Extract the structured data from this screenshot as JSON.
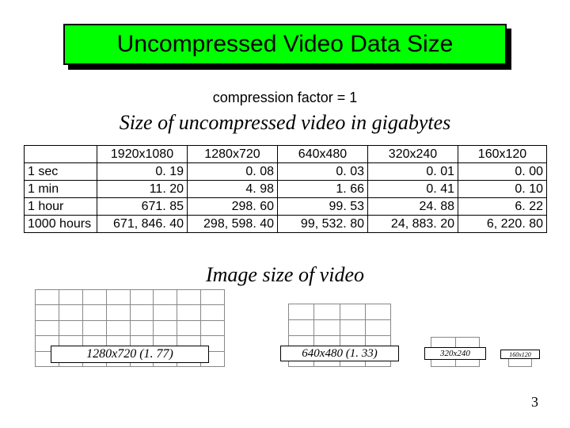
{
  "title": "Uncompressed Video Data Size",
  "compression_line": "compression factor = 1",
  "subtitle": "Size of uncompressed video in gigabytes",
  "chart_data": {
    "type": "table",
    "title": "Size of uncompressed video in gigabytes",
    "columns": [
      "",
      "1920x1080",
      "1280x720",
      "640x480",
      "320x240",
      "160x120"
    ],
    "rows": [
      {
        "label": "1 sec",
        "values": [
          "0. 19",
          "0. 08",
          "0. 03",
          "0. 01",
          "0. 00"
        ]
      },
      {
        "label": "1 min",
        "values": [
          "11. 20",
          "4. 98",
          "1. 66",
          "0. 41",
          "0. 10"
        ]
      },
      {
        "label": "1 hour",
        "values": [
          "671. 85",
          "298. 60",
          "99. 53",
          "24. 88",
          "6. 22"
        ]
      },
      {
        "label": "1000 hours",
        "values": [
          "671, 846. 40",
          "298, 598. 40",
          "99, 532. 80",
          "24, 883. 20",
          "6, 220. 80"
        ]
      }
    ]
  },
  "image_size_title": "Image size of video",
  "image_boxes": [
    {
      "label": "1280x720 (1. 77)"
    },
    {
      "label": "640x480 (1. 33)"
    },
    {
      "label": "320x240"
    },
    {
      "label": "160x120"
    }
  ],
  "page_number": "3"
}
